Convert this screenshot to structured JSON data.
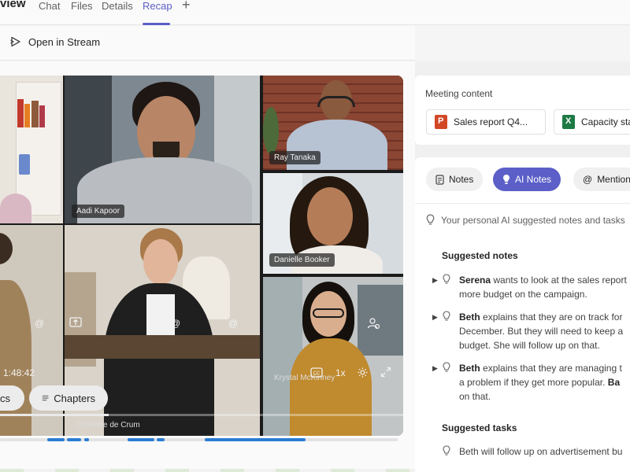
{
  "tabs": {
    "title": "view",
    "items": [
      {
        "label": "Chat"
      },
      {
        "label": "Files"
      },
      {
        "label": "Details"
      },
      {
        "label": "Recap",
        "active": true
      }
    ],
    "add_icon": "plus-icon"
  },
  "toolbar": {
    "open_stream_label": "Open in Stream",
    "open_stream_icon": "stream-play-icon"
  },
  "video": {
    "participants": [
      {
        "name": "Aadi Kapoor"
      },
      {
        "name": "Ray Tanaka"
      },
      {
        "name": "Danielle Booker"
      },
      {
        "name": "Charlotte de Crum"
      },
      {
        "name": "Krystal McKinney"
      }
    ],
    "elapsed_time": "1:48:42",
    "playback_speed": "1x",
    "progress_fraction": 0.27
  },
  "recap_tabs": {
    "speakers_partial": "cs",
    "chapters_label": "Chapters"
  },
  "accent_color": "#5b5fc7",
  "timeline_color": "#2b7cd3",
  "meeting_content": {
    "label": "Meeting content",
    "files": [
      {
        "name": "Sales report Q4...",
        "type": "powerpoint"
      },
      {
        "name": "Capacity sta",
        "type": "excel"
      }
    ]
  },
  "notes_tabs": [
    {
      "label": "Notes",
      "icon": "notes-icon"
    },
    {
      "label": "AI Notes",
      "icon": "bulb-icon",
      "active": true
    },
    {
      "label": "Mention",
      "icon": "at-icon"
    }
  ],
  "ai_hint": "Your personal AI suggested notes and tasks",
  "suggested_notes": {
    "heading": "Suggested notes",
    "items": [
      {
        "name": "Serena",
        "text": "wants to look at the sales report",
        "line2": "more budget on the campaign."
      },
      {
        "name": "Beth",
        "text": "explains that they are on track for",
        "line2": "December. But they will need to keep a",
        "line3": "budget. She will follow up on that."
      },
      {
        "name": "Beth",
        "text": "explains that they are managing t",
        "line2_pre": "a problem if they get more popular. ",
        "line2_bold": "Ba",
        "line3": "on that."
      }
    ]
  },
  "suggested_tasks": {
    "heading": "Suggested tasks",
    "items": [
      {
        "text": "Beth will follow up on advertisement bu"
      }
    ]
  }
}
